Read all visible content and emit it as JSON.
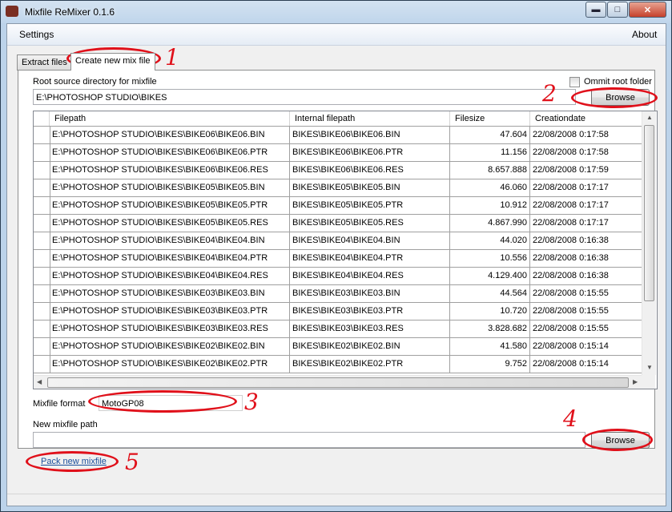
{
  "window": {
    "title": "Mixfile ReMixer 0.1.6"
  },
  "menu": {
    "settings": "Settings",
    "about": "About"
  },
  "tabs": [
    {
      "label": "Extract files"
    },
    {
      "label": "Create new mix file"
    }
  ],
  "source": {
    "label": "Root source directory for mixfile",
    "path": "E:\\PHOTOSHOP STUDIO\\BIKES",
    "omit_label": "Ommit root folder",
    "browse_label": "Browse"
  },
  "grid": {
    "columns": [
      "Filepath",
      "Internal filepath",
      "Filesize",
      "Creationdate"
    ],
    "rows": [
      [
        "E:\\PHOTOSHOP STUDIO\\BIKES\\BIKE06\\BIKE06.BIN",
        "BIKES\\BIKE06\\BIKE06.BIN",
        "47.604",
        "22/08/2008 0:17:58"
      ],
      [
        "E:\\PHOTOSHOP STUDIO\\BIKES\\BIKE06\\BIKE06.PTR",
        "BIKES\\BIKE06\\BIKE06.PTR",
        "11.156",
        "22/08/2008 0:17:58"
      ],
      [
        "E:\\PHOTOSHOP STUDIO\\BIKES\\BIKE06\\BIKE06.RES",
        "BIKES\\BIKE06\\BIKE06.RES",
        "8.657.888",
        "22/08/2008 0:17:59"
      ],
      [
        "E:\\PHOTOSHOP STUDIO\\BIKES\\BIKE05\\BIKE05.BIN",
        "BIKES\\BIKE05\\BIKE05.BIN",
        "46.060",
        "22/08/2008 0:17:17"
      ],
      [
        "E:\\PHOTOSHOP STUDIO\\BIKES\\BIKE05\\BIKE05.PTR",
        "BIKES\\BIKE05\\BIKE05.PTR",
        "10.912",
        "22/08/2008 0:17:17"
      ],
      [
        "E:\\PHOTOSHOP STUDIO\\BIKES\\BIKE05\\BIKE05.RES",
        "BIKES\\BIKE05\\BIKE05.RES",
        "4.867.990",
        "22/08/2008 0:17:17"
      ],
      [
        "E:\\PHOTOSHOP STUDIO\\BIKES\\BIKE04\\BIKE04.BIN",
        "BIKES\\BIKE04\\BIKE04.BIN",
        "44.020",
        "22/08/2008 0:16:38"
      ],
      [
        "E:\\PHOTOSHOP STUDIO\\BIKES\\BIKE04\\BIKE04.PTR",
        "BIKES\\BIKE04\\BIKE04.PTR",
        "10.556",
        "22/08/2008 0:16:38"
      ],
      [
        "E:\\PHOTOSHOP STUDIO\\BIKES\\BIKE04\\BIKE04.RES",
        "BIKES\\BIKE04\\BIKE04.RES",
        "4.129.400",
        "22/08/2008 0:16:38"
      ],
      [
        "E:\\PHOTOSHOP STUDIO\\BIKES\\BIKE03\\BIKE03.BIN",
        "BIKES\\BIKE03\\BIKE03.BIN",
        "44.564",
        "22/08/2008 0:15:55"
      ],
      [
        "E:\\PHOTOSHOP STUDIO\\BIKES\\BIKE03\\BIKE03.PTR",
        "BIKES\\BIKE03\\BIKE03.PTR",
        "10.720",
        "22/08/2008 0:15:55"
      ],
      [
        "E:\\PHOTOSHOP STUDIO\\BIKES\\BIKE03\\BIKE03.RES",
        "BIKES\\BIKE03\\BIKE03.RES",
        "3.828.682",
        "22/08/2008 0:15:55"
      ],
      [
        "E:\\PHOTOSHOP STUDIO\\BIKES\\BIKE02\\BIKE02.BIN",
        "BIKES\\BIKE02\\BIKE02.BIN",
        "41.580",
        "22/08/2008 0:15:14"
      ],
      [
        "E:\\PHOTOSHOP STUDIO\\BIKES\\BIKE02\\BIKE02.PTR",
        "BIKES\\BIKE02\\BIKE02.PTR",
        "9.752",
        "22/08/2008 0:15:14"
      ]
    ]
  },
  "format": {
    "label": "Mixfile format",
    "value": "MotoGP08"
  },
  "output": {
    "label": "New mixfile path",
    "path": "",
    "browse_label": "Browse"
  },
  "pack": {
    "label": "Pack new mixfile"
  },
  "annotations": [
    "1",
    "2",
    "3",
    "4",
    "5"
  ],
  "colors": {
    "annotation": "#e0101a",
    "link": "#1a4f9c",
    "titlebar": "#bcd3ea"
  }
}
